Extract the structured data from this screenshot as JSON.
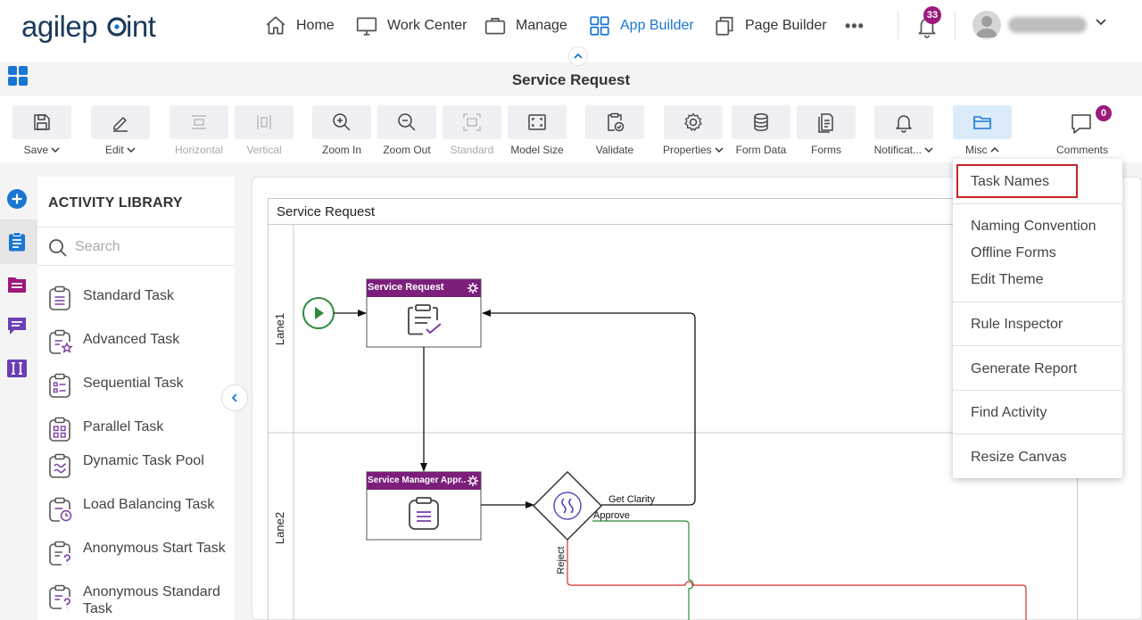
{
  "brand": {
    "logo_text": "agilepoint",
    "accent": "#1976d2",
    "logo_color": "#1a3a5c"
  },
  "nav": {
    "items": [
      {
        "label": "Home",
        "icon": "home-icon"
      },
      {
        "label": "Work Center",
        "icon": "monitor-icon"
      },
      {
        "label": "Manage",
        "icon": "briefcase-icon"
      },
      {
        "label": "App Builder",
        "icon": "apps-grid-icon",
        "active": true
      },
      {
        "label": "Page Builder",
        "icon": "pages-icon"
      }
    ],
    "more_label": "•••",
    "notifications_count": "33"
  },
  "titlebar": {
    "title": "Service Request"
  },
  "toolbar": {
    "save": "Save",
    "edit": "Edit",
    "horizontal": "Horizontal",
    "vertical": "Vertical",
    "zoom_in": "Zoom In",
    "zoom_out": "Zoom Out",
    "standard": "Standard",
    "model_size": "Model Size",
    "validate": "Validate",
    "properties": "Properties",
    "form_data": "Form Data",
    "forms": "Forms",
    "notifications": "Notificat...",
    "misc": "Misc",
    "comments": "Comments",
    "comments_count": "0"
  },
  "library": {
    "title": "ACTIVITY LIBRARY",
    "search_placeholder": "Search",
    "items": [
      {
        "label": "Standard Task",
        "icon": "standard-task-icon"
      },
      {
        "label": "Advanced Task",
        "icon": "advanced-task-icon"
      },
      {
        "label": "Sequential Task",
        "icon": "sequential-task-icon"
      },
      {
        "label": "Parallel Task",
        "icon": "parallel-task-icon"
      },
      {
        "label": "Dynamic Task Pool",
        "icon": "dynamic-task-pool-icon"
      },
      {
        "label": "Load Balancing Task",
        "icon": "load-balancing-task-icon"
      },
      {
        "label": "Anonymous Start Task",
        "icon": "anonymous-start-task-icon"
      },
      {
        "label": "Anonymous Standard Task",
        "icon": "anonymous-standard-task-icon"
      }
    ]
  },
  "canvas": {
    "pool_title": "Service Request",
    "lanes": [
      "Lane1",
      "Lane2"
    ],
    "task1": "Service Request",
    "task2": "Service Manager Appr...",
    "flows": {
      "get_clarity": "Get Clarity",
      "approve": "Approve",
      "reject": "Reject"
    },
    "task_header_color": "#7b1f7a"
  },
  "misc_menu": {
    "items": [
      "Task Names",
      "Naming Convention",
      "Offline Forms",
      "Edit Theme",
      "Rule Inspector",
      "Generate Report",
      "Find Activity",
      "Resize Canvas"
    ],
    "highlight_color": "#c62828"
  }
}
